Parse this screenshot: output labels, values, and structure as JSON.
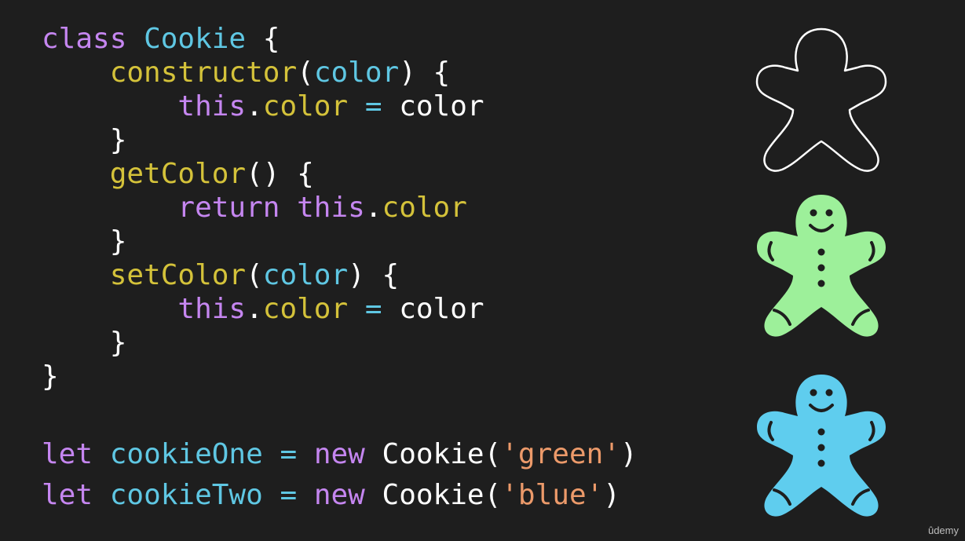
{
  "code": {
    "lines": [
      {
        "tokens": [
          {
            "t": "class",
            "c": "kw"
          },
          {
            "t": " ",
            "c": "plain"
          },
          {
            "t": "Cookie",
            "c": "cls"
          },
          {
            "t": " {",
            "c": "plain"
          }
        ]
      },
      {
        "tokens": [
          {
            "t": "    ",
            "c": "plain"
          },
          {
            "t": "constructor",
            "c": "fn"
          },
          {
            "t": "(",
            "c": "plain"
          },
          {
            "t": "color",
            "c": "param"
          },
          {
            "t": ") {",
            "c": "plain"
          }
        ]
      },
      {
        "tokens": [
          {
            "t": "        ",
            "c": "plain"
          },
          {
            "t": "this",
            "c": "kw"
          },
          {
            "t": ".",
            "c": "plain"
          },
          {
            "t": "color",
            "c": "prop"
          },
          {
            "t": " = ",
            "c": "op"
          },
          {
            "t": "color",
            "c": "plain"
          }
        ]
      },
      {
        "tokens": [
          {
            "t": "    }",
            "c": "plain"
          }
        ]
      },
      {
        "tokens": [
          {
            "t": "    ",
            "c": "plain"
          },
          {
            "t": "getColor",
            "c": "fn"
          },
          {
            "t": "() {",
            "c": "plain"
          }
        ]
      },
      {
        "tokens": [
          {
            "t": "        ",
            "c": "plain"
          },
          {
            "t": "return",
            "c": "kw"
          },
          {
            "t": " ",
            "c": "plain"
          },
          {
            "t": "this",
            "c": "kw"
          },
          {
            "t": ".",
            "c": "plain"
          },
          {
            "t": "color",
            "c": "prop"
          }
        ]
      },
      {
        "tokens": [
          {
            "t": "    }",
            "c": "plain"
          }
        ]
      },
      {
        "tokens": [
          {
            "t": "    ",
            "c": "plain"
          },
          {
            "t": "setColor",
            "c": "fn"
          },
          {
            "t": "(",
            "c": "plain"
          },
          {
            "t": "color",
            "c": "param"
          },
          {
            "t": ") {",
            "c": "plain"
          }
        ]
      },
      {
        "tokens": [
          {
            "t": "        ",
            "c": "plain"
          },
          {
            "t": "this",
            "c": "kw"
          },
          {
            "t": ".",
            "c": "plain"
          },
          {
            "t": "color",
            "c": "prop"
          },
          {
            "t": " = ",
            "c": "op"
          },
          {
            "t": "color",
            "c": "plain"
          }
        ]
      },
      {
        "tokens": [
          {
            "t": "    }",
            "c": "plain"
          }
        ]
      },
      {
        "tokens": [
          {
            "t": "}",
            "c": "plain"
          }
        ]
      }
    ],
    "instances": [
      {
        "tokens": [
          {
            "t": "let",
            "c": "kw"
          },
          {
            "t": " ",
            "c": "plain"
          },
          {
            "t": "cookieOne",
            "c": "param"
          },
          {
            "t": " = ",
            "c": "op"
          },
          {
            "t": "new",
            "c": "kw"
          },
          {
            "t": " Cookie(",
            "c": "plain"
          },
          {
            "t": "'green'",
            "c": "str"
          },
          {
            "t": ")",
            "c": "plain"
          }
        ]
      },
      {
        "tokens": [
          {
            "t": "let",
            "c": "kw"
          },
          {
            "t": " ",
            "c": "plain"
          },
          {
            "t": "cookieTwo",
            "c": "param"
          },
          {
            "t": " = ",
            "c": "op"
          },
          {
            "t": "new",
            "c": "kw"
          },
          {
            "t": " Cookie(",
            "c": "plain"
          },
          {
            "t": "'blue'",
            "c": "str"
          },
          {
            "t": ")",
            "c": "plain"
          }
        ]
      }
    ]
  },
  "cookies": [
    {
      "name": "outline",
      "fill": "none",
      "stroke": "#ffffff"
    },
    {
      "name": "green",
      "fill": "#9df09a",
      "stroke": "none"
    },
    {
      "name": "blue",
      "fill": "#5fcdee",
      "stroke": "none"
    }
  ],
  "watermark": "ûdemy"
}
